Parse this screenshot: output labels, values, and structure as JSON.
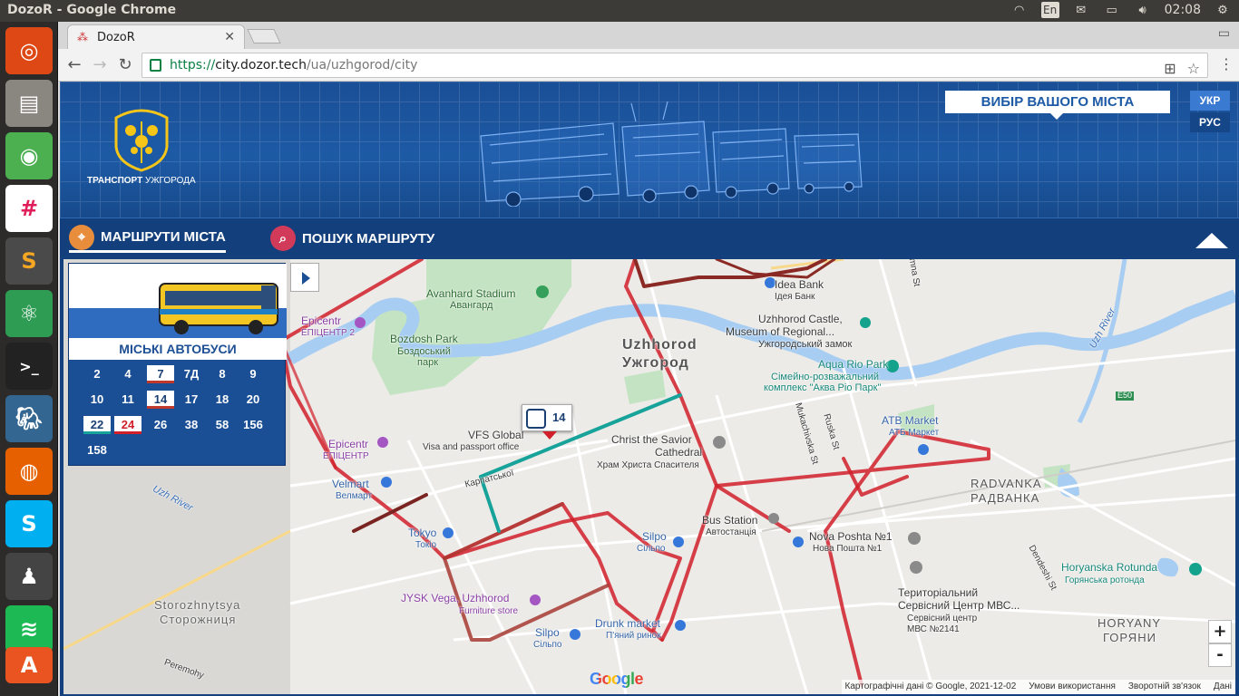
{
  "os": {
    "window_title": "DozoR - Google Chrome",
    "keyboard_layout": "En",
    "clock": "02:08"
  },
  "browser": {
    "tab_title": "DozoR",
    "url_scheme": "https://",
    "url_host": "city.dozor.tech",
    "url_path": "/ua/uzhgorod/city"
  },
  "header": {
    "logo_text_bold": "ТРАНСПОРТ",
    "logo_text": "УЖГОРОДА",
    "city_select": "ВИБІР ВАШОГО МІСТА",
    "lang_ukr": "УКР",
    "lang_rus": "РУС"
  },
  "nav": {
    "routes_label": "МАРШРУТИ МІСТА",
    "search_label": "ПОШУК МАРШРУТУ"
  },
  "panel": {
    "category": "МІСЬКІ АВТОБУСИ",
    "routes": [
      {
        "label": "2",
        "state": "none"
      },
      {
        "label": "4",
        "state": "none"
      },
      {
        "label": "7",
        "state": "sel"
      },
      {
        "label": "7Д",
        "state": "none"
      },
      {
        "label": "8",
        "state": "none"
      },
      {
        "label": "9",
        "state": "none"
      },
      {
        "label": "10",
        "state": "none"
      },
      {
        "label": "11",
        "state": "none"
      },
      {
        "label": "14",
        "state": "sel"
      },
      {
        "label": "17",
        "state": "none"
      },
      {
        "label": "18",
        "state": "none"
      },
      {
        "label": "20",
        "state": "none"
      },
      {
        "label": "22",
        "state": "sel-teal"
      },
      {
        "label": "24",
        "state": "sel-red"
      },
      {
        "label": "26",
        "state": "none"
      },
      {
        "label": "38",
        "state": "none"
      },
      {
        "label": "58",
        "state": "none"
      },
      {
        "label": "156",
        "state": "none"
      },
      {
        "label": "158",
        "state": "none"
      }
    ]
  },
  "map": {
    "bus_marker_number": "14",
    "labels": {
      "avanhard": "Avanhard Stadium",
      "avanhard_uk": "Авангард",
      "epicentr2": "Epicentr",
      "epicentr2_uk": "ЕПІЦЕНТР 2",
      "bozdosh": "Bozdosh Park",
      "bozdosh_uk1": "Боздоський",
      "bozdosh_uk2": "парк",
      "uzhhorod": "Uzhhorod",
      "uzhhorod_uk": "Ужгород",
      "castle1": "Uzhhorod Castle,",
      "castle2": "Museum of Regional...",
      "castle_uk": "Ужгородський замок",
      "aqua": "Aqua Rio Park",
      "aqua_uk1": "Сімейно-розважальний",
      "aqua_uk2": "комплекс \"Аква Ріо Парк\"",
      "idea": "Idea Bank",
      "idea_uk": "Ідея Банк",
      "vfs": "VFS Global",
      "vfs_sub": "Visa and passport office",
      "christ1": "Christ the Savior",
      "christ2": "Cathedral",
      "christ_uk": "Храм Христа Спасителя",
      "atb": "ATB Market",
      "atb_uk": "АТБ Маркет",
      "radvanka": "RADVANKA",
      "radvanka_uk": "РАДВАНКА",
      "epicentr": "Epicentr",
      "epicentr_uk": "ЕПІЦЕНТР",
      "velmart": "Velmart",
      "velmart_uk": "Велмарт",
      "bus_station": "Bus Station",
      "bus_station_uk": "Автостанція",
      "nova": "Nova Poshta №1",
      "nova_uk": "Нова Пошта №1",
      "tokio": "Tokyo",
      "tokio_uk": "Токіо",
      "silpo": "Silpo",
      "silpo_uk": "Сільпо",
      "horyanska": "Horyanska Rotunda",
      "horyanska_uk": "Горянська ротонда",
      "service1": "Територіальний",
      "service2": "Сервісний Центр МВС...",
      "service_uk1": "Сервісний центр",
      "service_uk2": "МВС №2141",
      "jysk": "JYSK Vega, Uzhhorod",
      "jysk_sub": "Furniture store",
      "silpo2": "Silpo",
      "silpo2_uk": "Сільпо",
      "drunk": "Drunk market",
      "drunk_uk": "П'яний ринок",
      "horyany": "HORYANY",
      "horyany_uk": "ГОРЯНИ",
      "storozh": "Storozhnytsya",
      "storozh_uk": "Сторожниця",
      "uzh_river": "Uzh River",
      "uzh_river2": "Uzh River",
      "mukach": "Mukachivska St",
      "ruska": "Ruska St",
      "dendeshi": "Dendeshi St",
      "perenohy": "Peremohy",
      "karp": "Карпатської",
      "e50": "E50",
      "mna": "mna St"
    },
    "zoom_in": "+",
    "zoom_out": "-",
    "google": "Google",
    "attribution": [
      "Картографічні дані © Google, 2021-12-02",
      "Умови використання",
      "Зворотній зв'язок",
      "Дані"
    ]
  },
  "colors": {
    "route_red": "#d1202a",
    "route_dark": "#8b2a24",
    "route_teal": "#17a39a",
    "brand_blue": "#1d5aa5"
  }
}
